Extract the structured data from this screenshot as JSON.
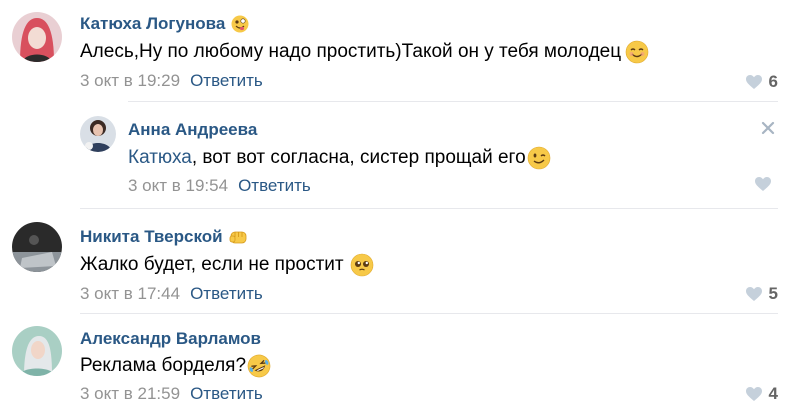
{
  "comments": [
    {
      "author": "Катюха Логунова",
      "text": "Алесь,Ну по любому надо простить)Такой он у тебя молодец",
      "date": "3 окт в 19:29",
      "reply_label": "Ответить",
      "likes": "6",
      "name_emoji": "zany-face",
      "text_emoji": "smiling-face"
    },
    {
      "author": "Анна Андреева",
      "mention": "Катюха",
      "text": ", вот вот согласна, систер прощай его",
      "date": "3 окт в 19:54",
      "reply_label": "Ответить",
      "likes": "",
      "text_emoji": "winking-face",
      "is_reply": true
    },
    {
      "author": "Никита Тверской",
      "text": "Жалко будет, если не простит",
      "date": "3 окт в 17:44",
      "reply_label": "Ответить",
      "likes": "5",
      "name_emoji": "oncoming-fist",
      "text_emoji": "pleading-face"
    },
    {
      "author": "Александр Варламов",
      "text": "Реклама борделя?",
      "date": "3 окт в 21:59",
      "reply_label": "Ответить",
      "likes": "4",
      "text_emoji": "rolling-laughing-face"
    }
  ],
  "colors": {
    "link": "#2a5885",
    "meta": "#939393",
    "heart": "#c5d0db",
    "divider": "#e7e8ec"
  }
}
